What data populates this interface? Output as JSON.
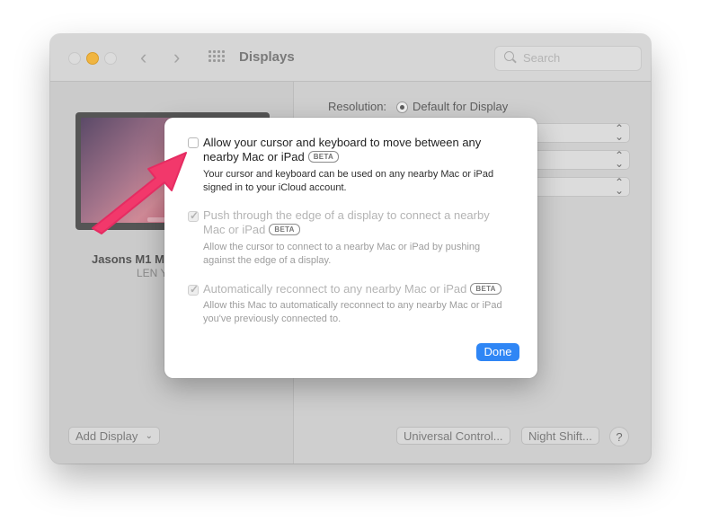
{
  "window": {
    "title": "Displays",
    "search": {
      "placeholder": "Search"
    }
  },
  "sidebar": {
    "display_name": "Jasons M1 M",
    "display_sub": "LEN Y",
    "add_display_label": "Add Display"
  },
  "main": {
    "resolution_label": "Resolution:",
    "resolution_value": "Default for Display"
  },
  "footer": {
    "universal_control_label": "Universal Control...",
    "night_shift_label": "Night Shift...",
    "help_label": "?"
  },
  "dialog": {
    "options": [
      {
        "label": "Allow your cursor and keyboard to move between any nearby Mac or iPad",
        "badge": "BETA",
        "checked": false,
        "enabled": true,
        "description": "Your cursor and keyboard can be used on any nearby Mac or iPad signed in to your iCloud account."
      },
      {
        "label": "Push through the edge of a display to connect a nearby Mac or iPad",
        "badge": "BETA",
        "checked": true,
        "enabled": false,
        "description": "Allow the cursor to connect to a nearby Mac or iPad by pushing against the edge of a display."
      },
      {
        "label": "Automatically reconnect to any nearby Mac or iPad",
        "badge": "BETA",
        "checked": true,
        "enabled": false,
        "description": "Allow this Mac to automatically reconnect to any nearby Mac or iPad you've previously connected to."
      }
    ],
    "done_label": "Done"
  },
  "colors": {
    "accent": "#2f86f5",
    "annotation_arrow": "#f2386b",
    "minimize_light": "#f0b541"
  },
  "icons": {
    "back": "chevron-left-icon",
    "forward": "chevron-right-icon",
    "grid": "grid-icon",
    "search": "search-icon",
    "annotation": "arrow-annotation-icon"
  }
}
